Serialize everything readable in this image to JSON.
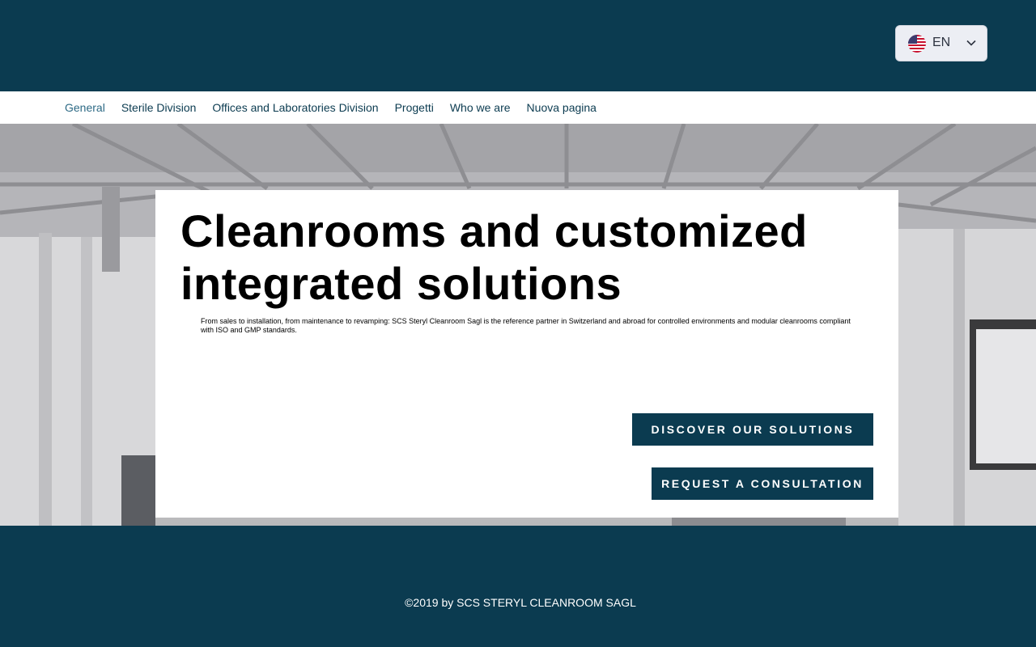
{
  "language_selector": {
    "label": "EN",
    "flag": "us-flag-icon"
  },
  "nav": {
    "items": [
      {
        "label": "General",
        "active": true
      },
      {
        "label": "Sterile Division"
      },
      {
        "label": "Offices and Laboratories Division"
      },
      {
        "label": "Progetti"
      },
      {
        "label": "Who we are"
      },
      {
        "label": "Nuova pagina"
      }
    ]
  },
  "hero": {
    "title": "Cleanrooms and customized integrated solutions",
    "description": "From sales to installation, from maintenance to revamping: SCS Steryl Cleanroom Sagl is the reference partner in Switzerland and abroad for controlled environments and modular cleanrooms compliant with ISO and GMP standards.",
    "buttons": {
      "discover": "DISCOVER OUR SOLUTIONS",
      "request": "REQUEST A CONSULTATION"
    }
  },
  "footer": {
    "copyright": "©2019 by SCS STERYL CLEANROOM SAGL"
  },
  "colors": {
    "primary": "#0b3b50",
    "nav_text": "#0b3b50",
    "active_nav": "#2d6a85"
  }
}
